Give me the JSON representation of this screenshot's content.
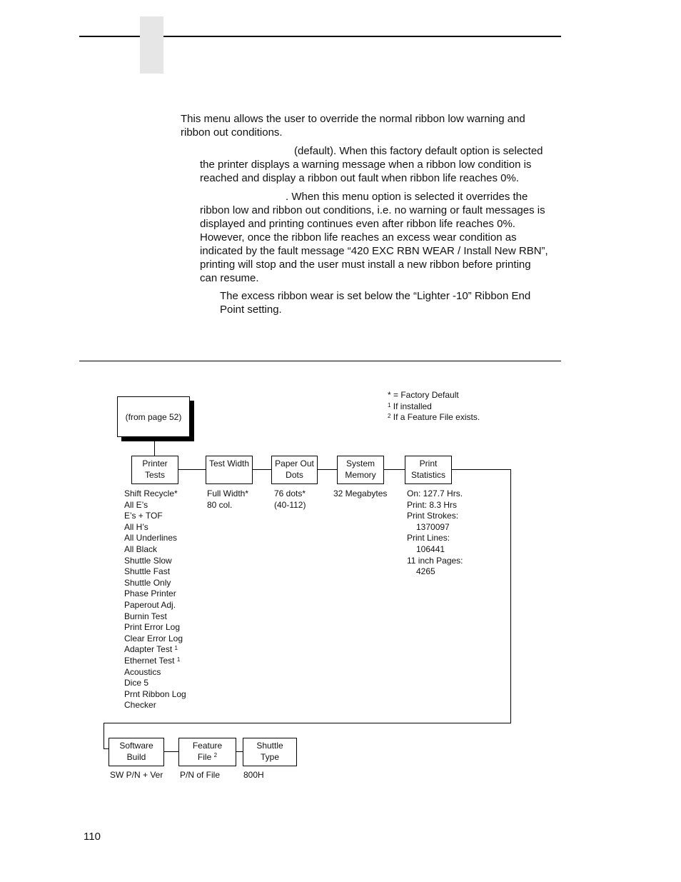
{
  "intro": {
    "line1": "This menu allows the user to override the normal ribbon low warning and",
    "line2": "ribbon out conditions."
  },
  "option_default": {
    "lines": [
      "(default). When this factory default option is selected",
      "the printer displays a warning message when a ribbon low condition is",
      "reached and display a ribbon out fault when ribbon life reaches 0%."
    ]
  },
  "option_override": {
    "lines": [
      ". When this menu option is selected it overrides the",
      "ribbon low and ribbon out conditions, i.e. no warning or fault messages is",
      "displayed and printing continues even after ribbon life reaches 0%.",
      "However, once the ribbon life reaches an excess wear condition as",
      "indicated by the fault message “420 EXC RBN WEAR / Install New RBN”,",
      "printing will stop and the user must install a new ribbon before printing",
      "can resume."
    ]
  },
  "note": {
    "lines": [
      "The excess ribbon wear is set below the “Lighter -10” Ribbon End",
      "Point setting."
    ]
  },
  "legend": {
    "factory_default": "* = Factory Default",
    "note1_mark": "1",
    "note1": "If installed",
    "note2_mark": "2",
    "note2": "If a Feature File exists."
  },
  "diagram": {
    "entry_box": "(from page 52)",
    "row1": [
      {
        "line1": "Printer",
        "line2": "Tests",
        "options": [
          "Shift Recycle*",
          "All E’s",
          "E’s + TOF",
          "All H’s",
          "All Underlines",
          "All Black",
          "Shuttle Slow",
          "Shuttle Fast",
          "Shuttle Only",
          "Phase Printer",
          "Paperout Adj.",
          "Burnin Test",
          "Print Error Log",
          "Clear Error Log",
          "Adapter Test",
          "Ethernet Test",
          "Acoustics",
          "Dice 5",
          "Prnt Ribbon Log",
          "Checker"
        ],
        "superscripts": {
          "14": "1",
          "15": "1"
        }
      },
      {
        "line1": "Test Width",
        "line2": "",
        "options": [
          "Full Width*",
          "80 col."
        ]
      },
      {
        "line1": "Paper Out",
        "line2": "Dots",
        "options": [
          "76 dots*",
          "(40-112)"
        ]
      },
      {
        "line1": "System",
        "line2": "Memory",
        "options": [
          "32 Megabytes"
        ]
      },
      {
        "line1": "Print",
        "line2": "Statistics",
        "options": [
          "On: 127.7 Hrs.",
          "Print: 8.3 Hrs",
          "Print Strokes:",
          "1370097",
          "Print Lines:",
          "106441",
          "11 inch Pages:",
          "4265"
        ]
      }
    ],
    "row2": [
      {
        "line1": "Software",
        "line2": "Build",
        "value": "SW P/N + Ver"
      },
      {
        "line1": "Feature",
        "line2": "File",
        "sup": "2",
        "value": "P/N of File"
      },
      {
        "line1": "Shuttle",
        "line2": "Type",
        "value": "800H"
      }
    ]
  },
  "page_number": "110"
}
